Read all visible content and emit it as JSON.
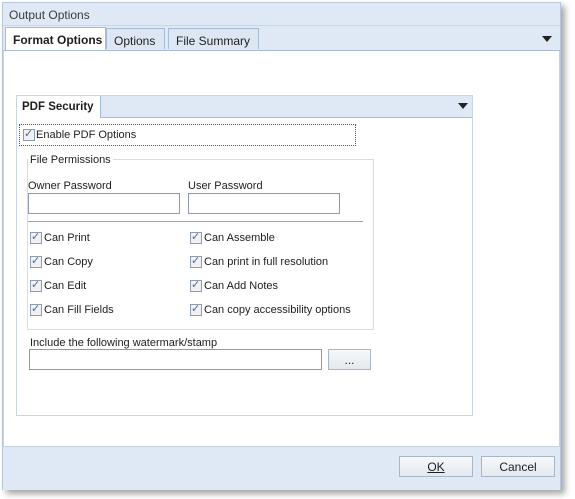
{
  "window": {
    "title": "Output Options"
  },
  "tabs": [
    {
      "label": "Format Options",
      "active": true
    },
    {
      "label": "Options",
      "active": false
    },
    {
      "label": "File Summary",
      "active": false
    }
  ],
  "pdf_security": {
    "tab_label": "PDF Security",
    "enable_label": "Enable PDF Options",
    "enable_checked": true,
    "group_title": "File Permissions",
    "owner_password_label": "Owner Password",
    "owner_password_value": "",
    "user_password_label": "User Password",
    "user_password_value": "",
    "permissions": [
      {
        "label": "Can Print",
        "checked": true
      },
      {
        "label": "Can Assemble",
        "checked": true
      },
      {
        "label": "Can Copy",
        "checked": true
      },
      {
        "label": "Can print in full resolution",
        "checked": true
      },
      {
        "label": "Can Edit",
        "checked": true
      },
      {
        "label": "Can Add Notes",
        "checked": true
      },
      {
        "label": "Can Fill Fields",
        "checked": true
      },
      {
        "label": "Can copy accessibility options",
        "checked": true
      }
    ],
    "watermark_label": "Include the following watermark/stamp",
    "watermark_value": "",
    "browse_label": "..."
  },
  "footer": {
    "ok_label": "OK",
    "cancel_label": "Cancel"
  },
  "colors": {
    "header_bg": "#dfe9f5",
    "border": "#a8bcd6",
    "separator": "#8aa6c9"
  }
}
